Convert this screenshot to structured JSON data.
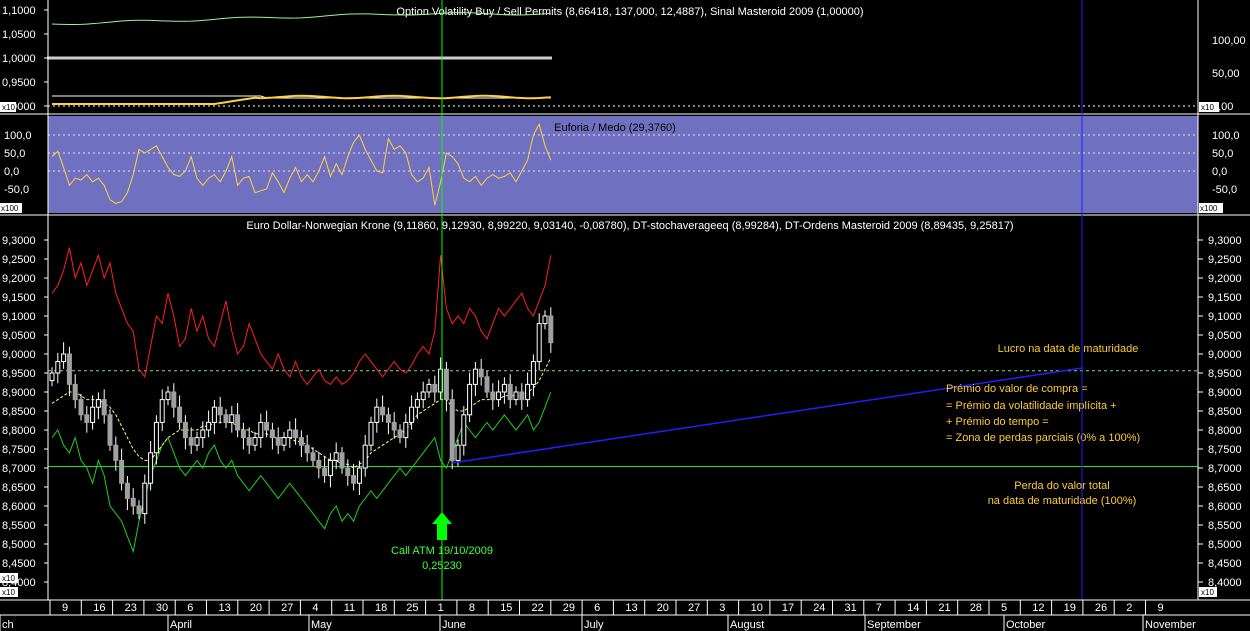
{
  "panels": {
    "top": {
      "title": "Option Volatility Buy / Sell Permits (8,66418, 137,000, 12,4887), Sinal Masteroid 2009 (1,00000)",
      "left_ticks": [
        "1,1000",
        "1,0500",
        "1,0000",
        "0,9500",
        "0,9000"
      ],
      "right_ticks": [
        "100,00",
        "50,00",
        "0,00"
      ],
      "multiplier": "x10"
    },
    "middle": {
      "title": "Euforia / Medo (29,3760)",
      "ticks": [
        "100,0",
        "50,0",
        "0,0",
        "-50,0"
      ],
      "multiplier": "x100"
    },
    "main": {
      "title": "Euro Dollar-Norwegian Krone (9,11860, 9,12930, 8,99220, 9,03140, -0,08780), DT-stochaverageeq (8,99284), DT-Ordens Masteroid 2009 (8,89435, 9,25817)",
      "ticks": [
        "9,3000",
        "9,2500",
        "9,2000",
        "9,1500",
        "9,1000",
        "9,0500",
        "9,0000",
        "8,9500",
        "8,9000",
        "8,8500",
        "8,8000",
        "8,7500",
        "8,7000",
        "8,6500",
        "8,6000",
        "8,5500",
        "8,5000",
        "8,4500",
        "8,4000"
      ],
      "multiplier": "x10"
    }
  },
  "annotations": {
    "lucro": "Lucro na data de maturidade",
    "premio": [
      "Prémio do valor de compra =",
      "= Prémio da volatilidade implícita +",
      "+ Prémio do tempo =",
      "= Zona de perdas parciais (0% a 100%)"
    ],
    "perda": [
      "Perda do valor total",
      "na data de maturidade (100%)"
    ],
    "call": [
      "Call ATM 19/10/2009",
      "0,25230"
    ]
  },
  "xaxis": {
    "days": [
      "9",
      "16",
      "23",
      "30",
      "6",
      "13",
      "20",
      "27",
      "4",
      "11",
      "18",
      "25",
      "1",
      "8",
      "15",
      "22",
      "29",
      "6",
      "13",
      "20",
      "27",
      "3",
      "10",
      "17",
      "24",
      "31",
      "7",
      "14",
      "21",
      "28",
      "5",
      "12",
      "19",
      "26",
      "2",
      "9"
    ],
    "months": [
      "ch",
      "April",
      "May",
      "June",
      "July",
      "August",
      "September",
      "October",
      "November"
    ]
  },
  "colors": {
    "upper_band": "#ff2020",
    "lower_band": "#20d020",
    "stoch": "#ffff80",
    "oscillator": "#ffd040",
    "middle_bg": "#7070c0",
    "cursor_green": "#00ff00",
    "cursor_blue": "#2020ff",
    "annotation": "#ffcc33"
  },
  "chart_data": {
    "type": "candlestick",
    "series": [
      {
        "name": "Euro Dollar-Norwegian Krone",
        "close": [
          8.95,
          8.98,
          9.0,
          8.92,
          8.88,
          8.84,
          8.82,
          8.86,
          8.88,
          8.84,
          8.76,
          8.72,
          8.66,
          8.62,
          8.6,
          8.58,
          8.66,
          8.74,
          8.82,
          8.88,
          8.9,
          8.86,
          8.82,
          8.78,
          8.76,
          8.78,
          8.8,
          8.82,
          8.86,
          8.84,
          8.82,
          8.84,
          8.8,
          8.78,
          8.76,
          8.78,
          8.82,
          8.8,
          8.78,
          8.76,
          8.78,
          8.8,
          8.78,
          8.76,
          8.74,
          8.72,
          8.7,
          8.68,
          8.72,
          8.74,
          8.7,
          8.68,
          8.66,
          8.7,
          8.76,
          8.82,
          8.86,
          8.84,
          8.82,
          8.8,
          8.78,
          8.82,
          8.86,
          8.88,
          8.9,
          8.92,
          8.9,
          8.96,
          8.88,
          8.72,
          8.76,
          8.84,
          8.92,
          8.96,
          8.94,
          8.9,
          8.88,
          8.9,
          8.92,
          8.88,
          8.9,
          8.88,
          8.92,
          8.98,
          9.08,
          9.1,
          9.03
        ]
      },
      {
        "name": "DT-Ordens Masteroid 2009 (upper)",
        "values": [
          9.16,
          9.18,
          9.22,
          9.28,
          9.2,
          9.24,
          9.18,
          9.22,
          9.26,
          9.2,
          9.24,
          9.16,
          9.12,
          9.08,
          9.06,
          8.96,
          8.94,
          9.02,
          9.1,
          9.08,
          9.16,
          9.1,
          9.02,
          9.04,
          9.12,
          9.06,
          9.1,
          9.04,
          9.02,
          9.08,
          9.14,
          9.06,
          9.0,
          9.02,
          9.08,
          9.04,
          9.0,
          8.98,
          8.96,
          9.0,
          8.96,
          8.94,
          8.98,
          8.94,
          8.92,
          8.94,
          8.96,
          8.93,
          8.92,
          8.94,
          8.92,
          8.93,
          8.95,
          8.98,
          9.0,
          8.98,
          8.96,
          8.94,
          8.96,
          8.98,
          8.96,
          8.95,
          8.97,
          9.0,
          9.02,
          9.0,
          9.06,
          9.26,
          9.12,
          9.08,
          9.1,
          9.08,
          9.12,
          9.1,
          9.06,
          9.04,
          9.08,
          9.12,
          9.1,
          9.12,
          9.14,
          9.16,
          9.12,
          9.1,
          9.14,
          9.18,
          9.26
        ]
      },
      {
        "name": "DT-Ordens Masteroid 2009 (lower)",
        "values": [
          8.78,
          8.8,
          8.76,
          8.74,
          8.78,
          8.72,
          8.7,
          8.66,
          8.72,
          8.68,
          8.6,
          8.58,
          8.56,
          8.52,
          8.48,
          8.56,
          8.62,
          8.68,
          8.72,
          8.76,
          8.78,
          8.74,
          8.7,
          8.68,
          8.7,
          8.72,
          8.7,
          8.74,
          8.76,
          8.72,
          8.7,
          8.72,
          8.68,
          8.66,
          8.64,
          8.66,
          8.68,
          8.66,
          8.64,
          8.62,
          8.64,
          8.66,
          8.64,
          8.62,
          8.6,
          8.58,
          8.56,
          8.54,
          8.58,
          8.6,
          8.56,
          8.58,
          8.56,
          8.6,
          8.62,
          8.64,
          8.62,
          8.64,
          8.66,
          8.68,
          8.7,
          8.68,
          8.7,
          8.72,
          8.74,
          8.76,
          8.78,
          8.72,
          8.7,
          8.74,
          8.78,
          8.82,
          8.8,
          8.78,
          8.8,
          8.82,
          8.8,
          8.82,
          8.84,
          8.82,
          8.8,
          8.82,
          8.84,
          8.8,
          8.82,
          8.86,
          8.9
        ]
      },
      {
        "name": "DT-stochaverageeq",
        "values": [
          8.87,
          8.88,
          8.89,
          8.9,
          8.9,
          8.89,
          8.88,
          8.88,
          8.88,
          8.87,
          8.86,
          8.84,
          8.81,
          8.78,
          8.75,
          8.73,
          8.72,
          8.72,
          8.74,
          8.76,
          8.78,
          8.79,
          8.8,
          8.8,
          8.8,
          8.8,
          8.81,
          8.81,
          8.82,
          8.82,
          8.82,
          8.82,
          8.81,
          8.8,
          8.8,
          8.79,
          8.79,
          8.79,
          8.78,
          8.78,
          8.78,
          8.78,
          8.77,
          8.77,
          8.76,
          8.75,
          8.74,
          8.73,
          8.72,
          8.72,
          8.71,
          8.71,
          8.7,
          8.71,
          8.72,
          8.74,
          8.75,
          8.76,
          8.77,
          8.78,
          8.79,
          8.8,
          8.82,
          8.84,
          8.85,
          8.86,
          8.87,
          8.88,
          8.88,
          8.86,
          8.85,
          8.85,
          8.86,
          8.87,
          8.88,
          8.88,
          8.88,
          8.88,
          8.89,
          8.89,
          8.89,
          8.89,
          8.9,
          8.91,
          8.93,
          8.96,
          8.99
        ]
      }
    ],
    "oscillator": {
      "name": "Euforia / Medo",
      "values": [
        40,
        55,
        10,
        -40,
        -20,
        -25,
        -10,
        -30,
        -20,
        -40,
        -80,
        -90,
        -85,
        -60,
        -10,
        60,
        50,
        60,
        70,
        40,
        10,
        -10,
        -15,
        0,
        40,
        -20,
        -40,
        -20,
        -10,
        -30,
        0,
        40,
        -40,
        -20,
        -15,
        -60,
        -55,
        -50,
        -5,
        -30,
        -60,
        -20,
        10,
        -30,
        -10,
        -30,
        0,
        40,
        -15,
        20,
        -10,
        40,
        80,
        100,
        60,
        30,
        0,
        -5,
        90,
        60,
        70,
        50,
        -10,
        -30,
        -20,
        10,
        -95,
        -30,
        50,
        40,
        20,
        -20,
        -30,
        -15,
        -40,
        -20,
        -10,
        -20,
        -15,
        -5,
        -30,
        0,
        30,
        100,
        130,
        70,
        30
      ]
    },
    "bands": [
      "#ffd040",
      "#ffffff"
    ],
    "hlines": [
      8.956,
      8.704
    ],
    "markers": [
      {
        "label": "Call ATM 19/10/2009",
        "value": "0,25230"
      }
    ],
    "ylim": [
      8.4,
      9.32
    ]
  }
}
